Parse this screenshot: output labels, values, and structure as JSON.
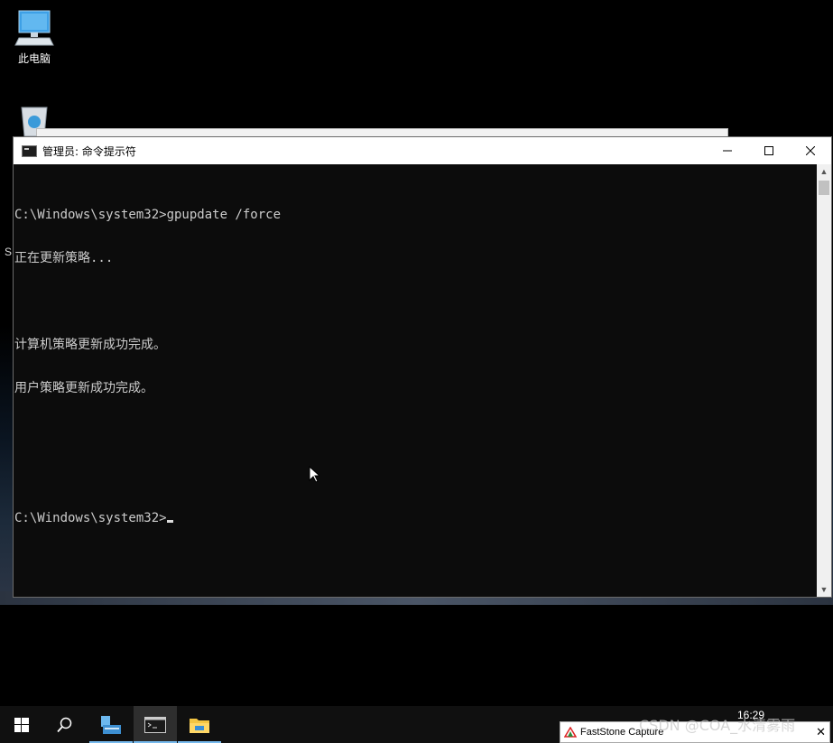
{
  "desktop": {
    "icons": [
      {
        "label": "此电脑",
        "icon": "computer-icon"
      },
      {
        "label": "",
        "icon": "recycle-bin-icon"
      }
    ],
    "side_fragment": "S"
  },
  "cmd_window": {
    "title": "管理员: 命令提示符",
    "buttons": {
      "minimize": "—",
      "maximize": "☐",
      "close": "✕"
    },
    "lines": [
      "C:\\Windows\\system32>gpupdate /force",
      "正在更新策略...",
      "",
      "计算机策略更新成功完成。",
      "用户策略更新成功完成。",
      "",
      "",
      "C:\\Windows\\system32>"
    ],
    "scroll_up": "▲",
    "scroll_down": "▼"
  },
  "taskbar": {
    "items": [
      "start-icon",
      "search-icon",
      "server-manager-icon",
      "cmd-icon",
      "file-explorer-icon"
    ],
    "clock": "16:29"
  },
  "faststone": {
    "label": "FastStone Capture",
    "close": "✕"
  },
  "watermark": "CSDN @COA_水清雾雨"
}
